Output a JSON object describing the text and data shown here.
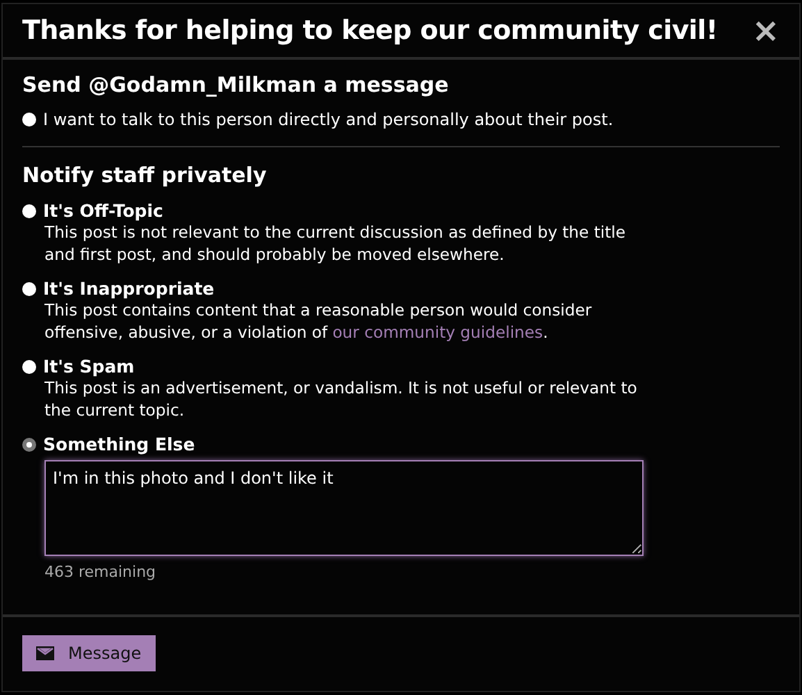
{
  "dialog": {
    "title": "Thanks for helping to keep our community civil!",
    "close": "×"
  },
  "message_section": {
    "heading": "Send @Godamn_Milkman a message",
    "option": {
      "label": "I want to talk to this person directly and personally about their post.",
      "selected": false
    }
  },
  "staff_section": {
    "heading": "Notify staff privately",
    "options": [
      {
        "kind": "plain",
        "title": "It's Off-Topic",
        "description": "This post is not relevant to the current discussion as defined by the title and first post, and should probably be moved elsewhere.",
        "selected": false
      },
      {
        "kind": "link",
        "title": "It's Inappropriate",
        "description": "This post contains content that a reasonable person would consider offensive, abusive, or a violation of ",
        "link": "our community guidelines",
        "after": ".",
        "selected": false
      },
      {
        "kind": "plain",
        "title": "It's Spam",
        "description": "This post is an advertisement, or vandalism. It is not useful or relevant to the current topic.",
        "selected": false
      },
      {
        "kind": "text",
        "title": "Something Else",
        "value": "I'm in this photo and I don't like it",
        "remaining": "463 remaining",
        "selected": true
      }
    ]
  },
  "footer": {
    "button": "Message"
  }
}
